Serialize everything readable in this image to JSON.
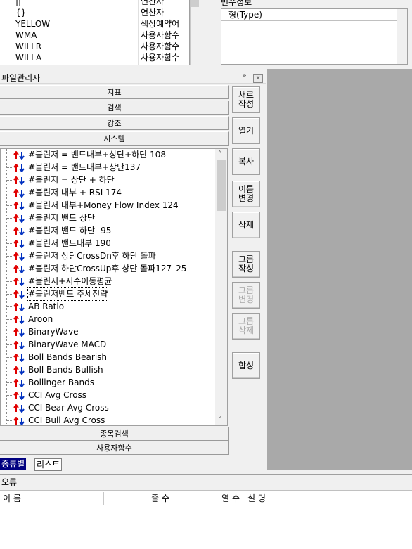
{
  "function_list": {
    "rows": [
      {
        "name": "||",
        "type": "연산자"
      },
      {
        "name": "{}",
        "type": "연산자"
      },
      {
        "name": "YELLOW",
        "type": "색상예약어"
      },
      {
        "name": "WMA",
        "type": "사용자함수"
      },
      {
        "name": "WILLR",
        "type": "사용자함수"
      },
      {
        "name": "WILLA",
        "type": "사용자함수"
      }
    ]
  },
  "variable_panel": {
    "label": "변수정보",
    "column_header": "형(Type)"
  },
  "file_manager": {
    "title": "파일관리자",
    "pin_glyph": "ᵖ",
    "close_glyph": "x",
    "categories_top": [
      "지표",
      "검색",
      "강조",
      "시스템"
    ],
    "categories_bottom": [
      "종목검색",
      "사용자함수"
    ],
    "tree_items": [
      "#볼린저 = 밴드내부+상단+하단 108",
      "#볼린저 = 밴드내부+상단137",
      "#볼린저 = 상단 + 하단",
      "#볼린저 내부 + RSI 174",
      "#볼린저 내부+Money Flow Index 124",
      "#볼린저 밴드 상단",
      "#볼린저 밴드 하단 -95",
      "#볼린저 밴드내부 190",
      "#볼린저 상단CrossDn후 하단 돌파",
      "#볼린저 하단CrossUp후 상단 돌파127_25",
      "#볼린저+지수이동평균",
      "#볼린저밴드 추세전략",
      "AB Ratio",
      "Aroon",
      "BinaryWave",
      "BinaryWave MACD",
      "Boll Bands Bearish",
      "Boll Bands Bullish",
      "Bollinger Bands",
      "CCI Avg Cross",
      "CCI Bear Avg Cross",
      "CCI Bull Avg Cross"
    ],
    "selected_item": "#볼린저밴드 추세전략",
    "scroll_up": "˄",
    "scroll_down": "˅",
    "buttons": [
      {
        "label": "새로\n작성",
        "enabled": true
      },
      {
        "label": "열기",
        "enabled": true
      },
      {
        "label": "복사",
        "enabled": true
      },
      {
        "label": "이름\n변경",
        "enabled": true
      },
      {
        "label": "삭제",
        "enabled": true
      },
      {
        "label": "그룹\n작성",
        "enabled": true
      },
      {
        "label": "그룹\n변경",
        "enabled": false
      },
      {
        "label": "그룹\n삭제",
        "enabled": false
      },
      {
        "label": "합성",
        "enabled": true
      }
    ],
    "tabs": [
      "종류별",
      "리스트"
    ],
    "active_tab": "종류별"
  },
  "error_panel": {
    "title": "오류",
    "columns": [
      "이 름",
      "줄 수",
      "열 수",
      "설 명"
    ]
  },
  "colors": {
    "arrow_up": "#e00000",
    "arrow_down": "#0030c0",
    "tab_active": "#000080",
    "workspace": "#a9a9a9"
  }
}
